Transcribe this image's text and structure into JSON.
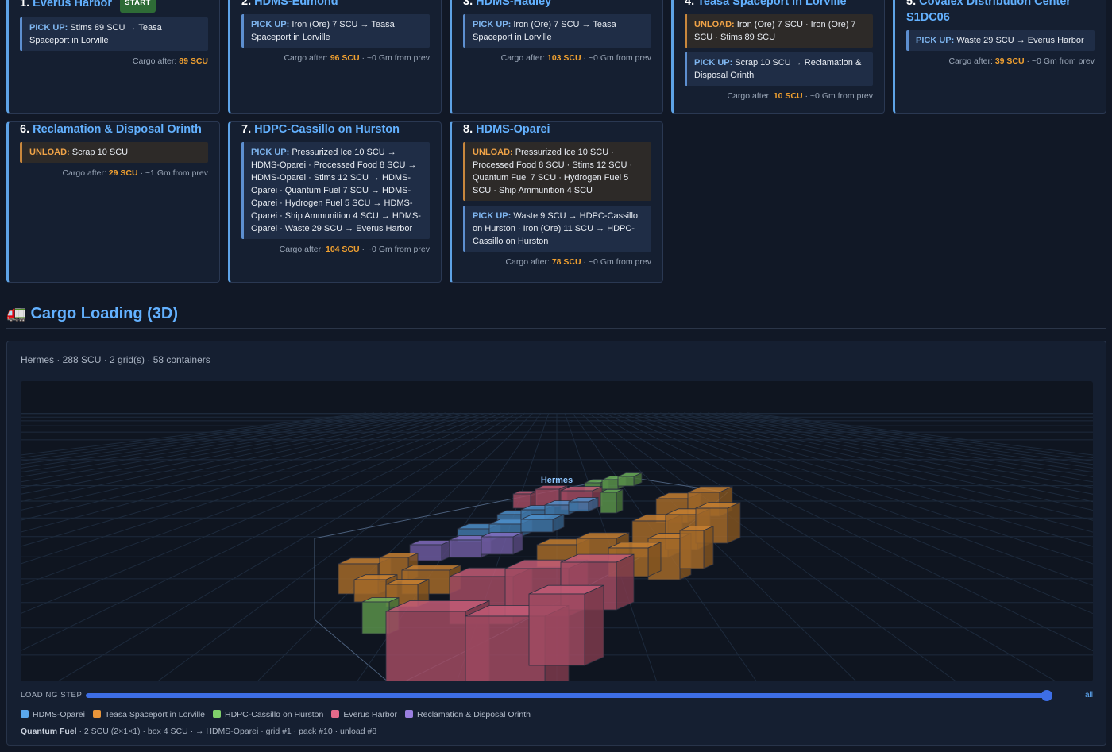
{
  "stops": [
    {
      "num": "1.",
      "name": "Everus Harbor",
      "badge": "START",
      "actions": [
        {
          "type": "pick",
          "label": "PICK UP:",
          "text": "Stims 89 SCU → Teasa Spaceport in Lorville"
        }
      ],
      "after_prefix": "Cargo after: ",
      "after_value": "89 SCU",
      "after_suffix": ""
    },
    {
      "num": "2.",
      "name": "HDMS-Edmond",
      "actions": [
        {
          "type": "pick",
          "label": "PICK UP:",
          "text": "Iron (Ore) 7 SCU → Teasa Spaceport in Lorville"
        }
      ],
      "after_prefix": "Cargo after: ",
      "after_value": "96 SCU",
      "after_suffix": " · ~0 Gm from prev"
    },
    {
      "num": "3.",
      "name": "HDMS-Hadley",
      "actions": [
        {
          "type": "pick",
          "label": "PICK UP:",
          "text": "Iron (Ore) 7 SCU → Teasa Spaceport in Lorville"
        }
      ],
      "after_prefix": "Cargo after: ",
      "after_value": "103 SCU",
      "after_suffix": " · ~0 Gm from prev"
    },
    {
      "num": "4.",
      "name": "Teasa Spaceport in Lorville",
      "actions": [
        {
          "type": "unload",
          "label": "UNLOAD:",
          "text": "Iron (Ore) 7 SCU · Iron (Ore) 7 SCU · Stims 89 SCU"
        },
        {
          "type": "pick",
          "label": "PICK UP:",
          "text": "Scrap 10 SCU → Reclamation & Disposal Orinth"
        }
      ],
      "after_prefix": "Cargo after: ",
      "after_value": "10 SCU",
      "after_suffix": " · ~0 Gm from prev"
    },
    {
      "num": "5.",
      "name": "Covalex Distribution Center S1DC06",
      "actions": [
        {
          "type": "pick",
          "label": "PICK UP:",
          "text": "Waste 29 SCU → Everus Harbor"
        }
      ],
      "after_prefix": "Cargo after: ",
      "after_value": "39 SCU",
      "after_suffix": " · ~0 Gm from prev"
    },
    {
      "num": "6.",
      "name": "Reclamation & Disposal Orinth",
      "actions": [
        {
          "type": "unload",
          "label": "UNLOAD:",
          "text": "Scrap 10 SCU"
        }
      ],
      "after_prefix": "Cargo after: ",
      "after_value": "29 SCU",
      "after_suffix": " · ~1 Gm from prev"
    },
    {
      "num": "7.",
      "name": "HDPC-Cassillo on Hurston",
      "actions": [
        {
          "type": "pick",
          "label": "PICK UP:",
          "text": "Pressurized Ice 10 SCU → HDMS-Oparei · Processed Food 8 SCU → HDMS-Oparei · Stims 12 SCU → HDMS-Oparei · Quantum Fuel 7 SCU → HDMS-Oparei · Hydrogen Fuel 5 SCU → HDMS-Oparei · Ship Ammunition 4 SCU → HDMS-Oparei · Waste 29 SCU → Everus Harbor"
        }
      ],
      "after_prefix": "Cargo after: ",
      "after_value": "104 SCU",
      "after_suffix": " · ~0 Gm from prev"
    },
    {
      "num": "8.",
      "name": "HDMS-Oparei",
      "actions": [
        {
          "type": "unload",
          "label": "UNLOAD:",
          "text": "Pressurized Ice 10 SCU · Processed Food 8 SCU · Stims 12 SCU · Quantum Fuel 7 SCU · Hydrogen Fuel 5 SCU · Ship Ammunition 4 SCU"
        },
        {
          "type": "pick",
          "label": "PICK UP:",
          "text": "Waste 9 SCU → HDPC-Cassillo on Hurston · Iron (Ore) 11 SCU → HDPC-Cassillo on Hurston"
        }
      ],
      "after_prefix": "Cargo after: ",
      "after_value": "78 SCU",
      "after_suffix": " · ~0 Gm from prev"
    }
  ],
  "section": {
    "icon": "🚛",
    "title": "Cargo Loading (3D)"
  },
  "summary": "Hermes · 288 SCU · 2 grid(s) · 58 containers",
  "ship_label": "Hermes",
  "slider": {
    "label": "LOADING STEP",
    "end_label": "all",
    "value_fraction": 1.0
  },
  "legend": [
    {
      "label": "HDMS-Oparei",
      "color": "#5aa8ee"
    },
    {
      "label": "Teasa Spaceport in Lorville",
      "color": "#e8953a"
    },
    {
      "label": "HDPC-Cassillo on Hurston",
      "color": "#7fcf6a"
    },
    {
      "label": "Everus Harbor",
      "color": "#e46a8a"
    },
    {
      "label": "Reclamation & Disposal Orinth",
      "color": "#9a7fe0"
    }
  ],
  "detail": {
    "name": "Quantum Fuel",
    "text": " · 2 SCU (2×1×1) · box 4 SCU · → HDMS-Oparei · grid #1 · pack #10 · unload #8"
  },
  "colors": {
    "accent": "#63b1ff",
    "cargo_value": "#f0a030",
    "start_badge": "#2e6b36"
  }
}
